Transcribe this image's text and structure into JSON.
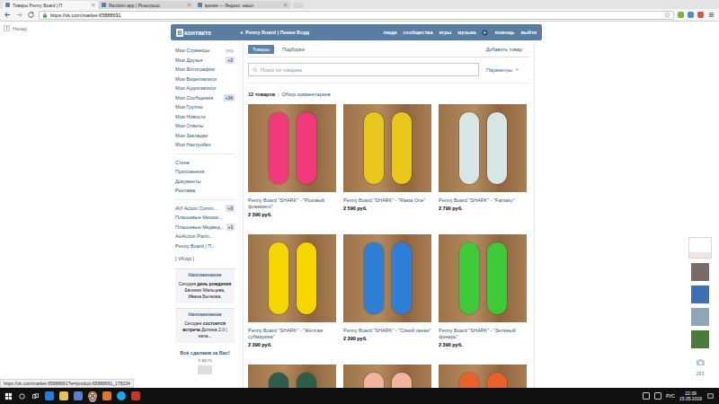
{
  "browser": {
    "tabs": [
      {
        "label": "Товары Penny Board | П",
        "selected": true
      },
      {
        "label": "Random.app | Розыгрыш",
        "selected": false
      },
      {
        "label": "время — Яндекс: нашл",
        "selected": false
      }
    ],
    "address": "https://vk.com/market-65888691"
  },
  "back_link": "Назад",
  "header": {
    "logo_badge": "В",
    "logo_text": "контакте",
    "group": "Penny Board | Пенни Борд",
    "nav": [
      "люди",
      "сообщества",
      "игры",
      "музыка",
      "помощь",
      "выйти"
    ]
  },
  "sidebar": {
    "edit_link": "ред.",
    "groups": [
      [
        {
          "label": "Мои Страницы"
        },
        {
          "label": "Мои Друзья",
          "badge": "+2"
        },
        {
          "label": "Мои Фотографии"
        },
        {
          "label": "Мои Видеозаписи"
        },
        {
          "label": "Мои Аудиозаписи"
        },
        {
          "label": "Мои Сообщения",
          "badge": "+26"
        },
        {
          "label": "Мои Группы"
        },
        {
          "label": "Мои Новости"
        },
        {
          "label": "Мои Ответы"
        },
        {
          "label": "Мои Закладки"
        },
        {
          "label": "Мои Настройки"
        }
      ],
      [
        {
          "label": "Стена"
        },
        {
          "label": "Приложения"
        },
        {
          "label": "Документы"
        },
        {
          "label": "Реклама"
        }
      ],
      [
        {
          "label": "AVI Action Comm...",
          "badge": "+3"
        },
        {
          "label": "Плюшевые Мишки..."
        },
        {
          "label": "Плюшевые Медвед...",
          "badge": "+1"
        },
        {
          "label": "AviAction Partn..."
        },
        {
          "label": "Penny Board | П..."
        }
      ]
    ],
    "vkopt": "[ VKopt ]"
  },
  "reminders": [
    {
      "title": "Напоминание",
      "lead": "Сегодня",
      "bold": "день рождения",
      "rest": "Евгении Мальцева, Ивана Бычкова."
    },
    {
      "title": "Напоминание",
      "lead": "Сегодня",
      "bold": "состоится встреча",
      "rest": "Долина 2.0 | нача..."
    }
  ],
  "ad": {
    "title": "Всё сделаем за Вас!",
    "domain": "z-ap.ru"
  },
  "market": {
    "tabs": [
      {
        "label": "Товары",
        "selected": true
      },
      {
        "label": "Подборки",
        "selected": false
      }
    ],
    "add_button": "Добавить товар",
    "search": {
      "placeholder": "Поиск по товарам"
    },
    "filter": "Параметры",
    "count": "12 товаров",
    "comments_link": "Обзор комментариев",
    "products": [
      {
        "title": "Penny Board \"SHARK\" - \"Розовый фламинго\"",
        "price": "2 390 руб.",
        "color": "#f2397c"
      },
      {
        "title": "Penny Board \"SHARK\" - \"Rasta One\"",
        "price": "2 590 руб.",
        "color": "#e9c61c"
      },
      {
        "title": "Penny Board \"SHARK\" - \"Fantasy\"",
        "price": "2 790 руб.",
        "color": "#d6e6e4"
      },
      {
        "title": "Penny Board \"SHARK\" - \"Жёлтая субмарина\"",
        "price": "2 390 руб.",
        "color": "#f5d600"
      },
      {
        "title": "Penny Board \"SHARK\" - \"Синий океан\"",
        "price": "2 390 руб.",
        "color": "#2f7fd6"
      },
      {
        "title": "Penny Board \"SHARK\" - \"Зелёный фонарь\"",
        "price": "2 390 руб.",
        "color": "#3fc93a"
      }
    ],
    "partial_products": [
      {
        "color": "#2f5d4a"
      },
      {
        "color": "#f2b49c"
      },
      {
        "color": "#e8602c"
      }
    ]
  },
  "chat": {
    "count": "263"
  },
  "status_url": "https://vk.com/market-65888691?w=product-65888691_178234",
  "taskbar": {
    "lang": "РУС",
    "time": "22:39",
    "date": "15.05.2016"
  }
}
